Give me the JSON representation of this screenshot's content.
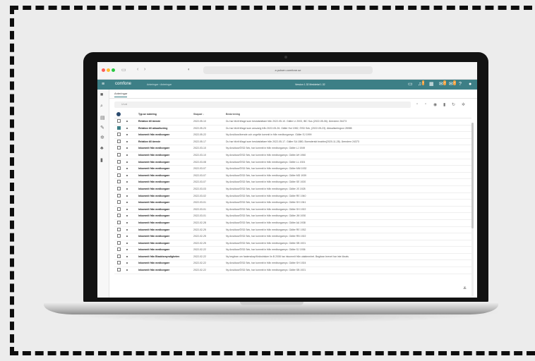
{
  "browser": {
    "url": "a pulsen.comfone.se",
    "nav": [
      "‹",
      "›"
    ]
  },
  "app": {
    "brand": "comfone",
    "breadcrumb": "Anteringar › Anteringar",
    "center_text": "Version 1.32 Meddelat 1.32",
    "badges": [
      "1",
      "4",
      "2"
    ]
  },
  "tabs": [
    "Anteringar"
  ],
  "filter": {
    "placeholder": "Urval"
  },
  "table": {
    "columns": [
      "Typ av notering",
      "Skapad ↓",
      "Beskrivning"
    ],
    "rows": [
      {
        "checked": false,
        "type": "Relation till ärende",
        "date": "2022-05-10",
        "desc": "Du har blivit tillagd som beslutsfattare från 2022-05-10. Gäller Lt 2003, IBC Sus (2022-05-06). Ärendenr 26473"
      },
      {
        "checked": true,
        "type": "Relation till aktualisering",
        "date": "2022-05-23",
        "desc": "Du har blivit tillagd som ansvarig från 2022-05-26. Gäller Hul 1982, ÖSD Sek, (2022-05-23). Aktualiseringsnr 28985"
      },
      {
        "checked": false,
        "type": "Inkommit från medborgare",
        "date": "2022-05-22",
        "desc": "Ny Ansökan/ärende och ungefär kommit in från medborgarnyx. Gäller SJ 1999"
      },
      {
        "checked": false,
        "type": "Relation till ärende",
        "date": "2022-05-17",
        "desc": "Du har blivit tillagd som beslutsfattare från 2022-05-17. Gäller SA 1880, Boenderskt bnabbn(2020-11-28). Ärendenr 24373"
      },
      {
        "checked": false,
        "type": "Inkommit från medborgare",
        "date": "2022-03-10",
        "desc": "Ny Ansökan/ÖSD Sek, har kommit in från medborgarnyx. Gäller LJ 1949"
      },
      {
        "checked": false,
        "type": "Inkommit från medborgare",
        "date": "2022-03-10",
        "desc": "Ny Ansökan/ÖSD Sek, har kommit in från medborgarnyx. Gäller AH 1960"
      },
      {
        "checked": false,
        "type": "Inkommit från medborgare",
        "date": "2022-03-08",
        "desc": "Ny Ansökan/ÖSD Sek, har kommit in från medborgarnyx. Gäller LL 1924"
      },
      {
        "checked": false,
        "type": "Inkommit från medborgare",
        "date": "2022-03-07",
        "desc": "Ny Ansökan/ÖSD Sek, har kommit in från medborgarnyx. Gäller MM 1932"
      },
      {
        "checked": false,
        "type": "Inkommit från medborgare",
        "date": "2022-03-07",
        "desc": "Ny Ansökan/ÖSD Sek, har kommit in från medborgarnyx. Gäller MD 1939"
      },
      {
        "checked": false,
        "type": "Inkommit från medborgare",
        "date": "2022-03-07",
        "desc": "Ny Ansökan/ÖSD Sek, har kommit in från medborgarnyx. Gäller SE 1920"
      },
      {
        "checked": false,
        "type": "Inkommit från medborgare",
        "date": "2022-03-03",
        "desc": "Ny Ansökan/ÖSD Sek, har kommit in från medborgarnyx. Gäller JS 1928"
      },
      {
        "checked": false,
        "type": "Inkommit från medborgare",
        "date": "2022-03-02",
        "desc": "Ny Ansökan/ÖSD Sek, har kommit in från medborgarnyx. Gäller RE 1940"
      },
      {
        "checked": false,
        "type": "Inkommit från medborgare",
        "date": "2022-03-01",
        "desc": "Ny Ansökan/ÖSD Sek, har kommit in från medborgarnyx. Gäller SH 1941"
      },
      {
        "checked": false,
        "type": "Inkommit från medborgare",
        "date": "2022-03-01",
        "desc": "Ny Ansökan/ÖSD Sek, har kommit in från medborgarnyx. Gäller SH 1922"
      },
      {
        "checked": false,
        "type": "Inkommit från medborgare",
        "date": "2022-03-01",
        "desc": "Ny Ansökan/ÖSD Sek, har kommit in från medborgarnyx. Gäller JM 1930"
      },
      {
        "checked": false,
        "type": "Inkommit från medborgare",
        "date": "2022-02-28",
        "desc": "Ny Ansökan/ÖSD Sek, har kommit in från medborgarnyx. Gäller AA 1938"
      },
      {
        "checked": false,
        "type": "Inkommit från medborgare",
        "date": "2022-02-25",
        "desc": "Ny Ansökan/ÖSD Sek, har kommit in från medborgarnyx. Gäller RE 1932"
      },
      {
        "checked": false,
        "type": "Inkommit från medborgare",
        "date": "2022-02-25",
        "desc": "Ny Ansökan/ÖSD Sek, har kommit in från medborgarnyx. Gäller RB 1922"
      },
      {
        "checked": false,
        "type": "Inkommit från medborgare",
        "date": "2022-02-25",
        "desc": "Ny Ansökan/ÖSD Sek, har kommit in från medborgarnyx. Gäller SB 1921"
      },
      {
        "checked": false,
        "type": "Inkommit från medborgare",
        "date": "2022-02-22",
        "desc": "Ny Ansökan/ÖSD Sek, har kommit in från medborgarnyx. Gäller SJ 1936"
      },
      {
        "checked": false,
        "type": "Inkommit från Bisaktsmyndigheten",
        "date": "2022-02-22",
        "desc": "Ny begäran om fastenskap/förändrisker lin B 2008 har inkommit från utaktmmlret. Begäran brevet har inte lönats"
      },
      {
        "checked": false,
        "type": "Inkommit från medborgare",
        "date": "2022-02-22",
        "desc": "Ny Ansökan/ÖSD Sek, har kommit in från medborgarnyx. Gäller SH 1924"
      },
      {
        "checked": false,
        "type": "Inkommit från medborgare",
        "date": "2022-02-22",
        "desc": "Ny Ansökan/ÖSD Sek, har kommit in från medborgarnyx. Gäller SB 1921"
      }
    ]
  },
  "colors": {
    "app_bar": "#3d7f86",
    "accent_badge": "#f4a340",
    "info_dot": "#2a4a6e"
  },
  "icons": [
    "menu-icon",
    "search-icon",
    "calendar-icon",
    "edit-icon",
    "settings-icon",
    "group-icon",
    "document-icon",
    "filter-icon",
    "eye-icon",
    "trash-icon",
    "refresh-icon",
    "gear-icon",
    "user-icon",
    "help-icon",
    "bell-icon"
  ]
}
